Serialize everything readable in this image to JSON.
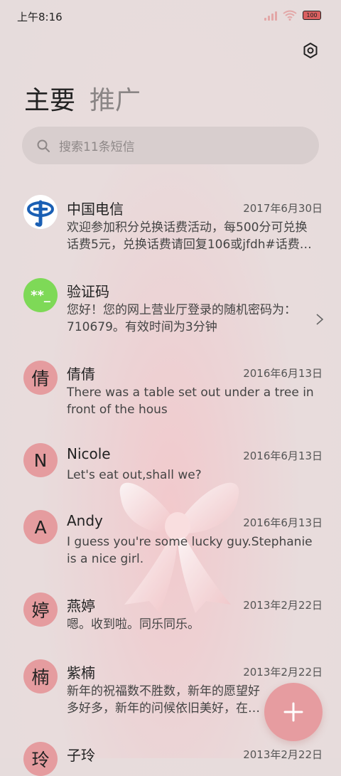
{
  "status": {
    "time": "上午8:16",
    "battery": "100"
  },
  "tabs": [
    {
      "label": "主要"
    },
    {
      "label": "推广"
    }
  ],
  "search": {
    "placeholder": "搜索11条短信"
  },
  "messages": [
    {
      "name": "中国电信",
      "date": "2017年6月30日",
      "preview": "欢迎参加积分兑换话费活动，每500分可兑换话费5元，兑换话费请回复106或jfdh#话费…",
      "avatar_type": "telecom-logo"
    },
    {
      "name": "验证码",
      "date": "",
      "preview": "您好！您的网上营业厅登录的随机密码为：710679。有效时间为3分钟",
      "avatar_text": "**_"
    },
    {
      "name": "倩倩",
      "date": "2016年6月13日",
      "preview": "There was a table set out under a tree in front of the hous",
      "avatar_text": "倩"
    },
    {
      "name": "Nicole",
      "date": "2016年6月13日",
      "preview": "Let's eat out,shall we?",
      "avatar_text": "N"
    },
    {
      "name": "Andy",
      "date": "2016年6月13日",
      "preview": "I guess you're some lucky guy.Stephanie is a nice girl.",
      "avatar_text": "A"
    },
    {
      "name": "燕婷",
      "date": "2013年2月22日",
      "preview": "嗯。收到啦。同乐同乐。",
      "avatar_text": "婷"
    },
    {
      "name": "紫楠",
      "date": "2013年2月22日",
      "preview": "新年的祝福数不胜数，新年的愿望好多好多，新年的问候依旧美好，在这个温馨的",
      "avatar_text": "楠"
    },
    {
      "name": "子玲",
      "date": "2013年2月22日",
      "preview": "",
      "avatar_text": "玲"
    }
  ],
  "colors": {
    "accent": "#e69ca0",
    "avatar": "#e59c9f",
    "verify": "#7ed957"
  }
}
